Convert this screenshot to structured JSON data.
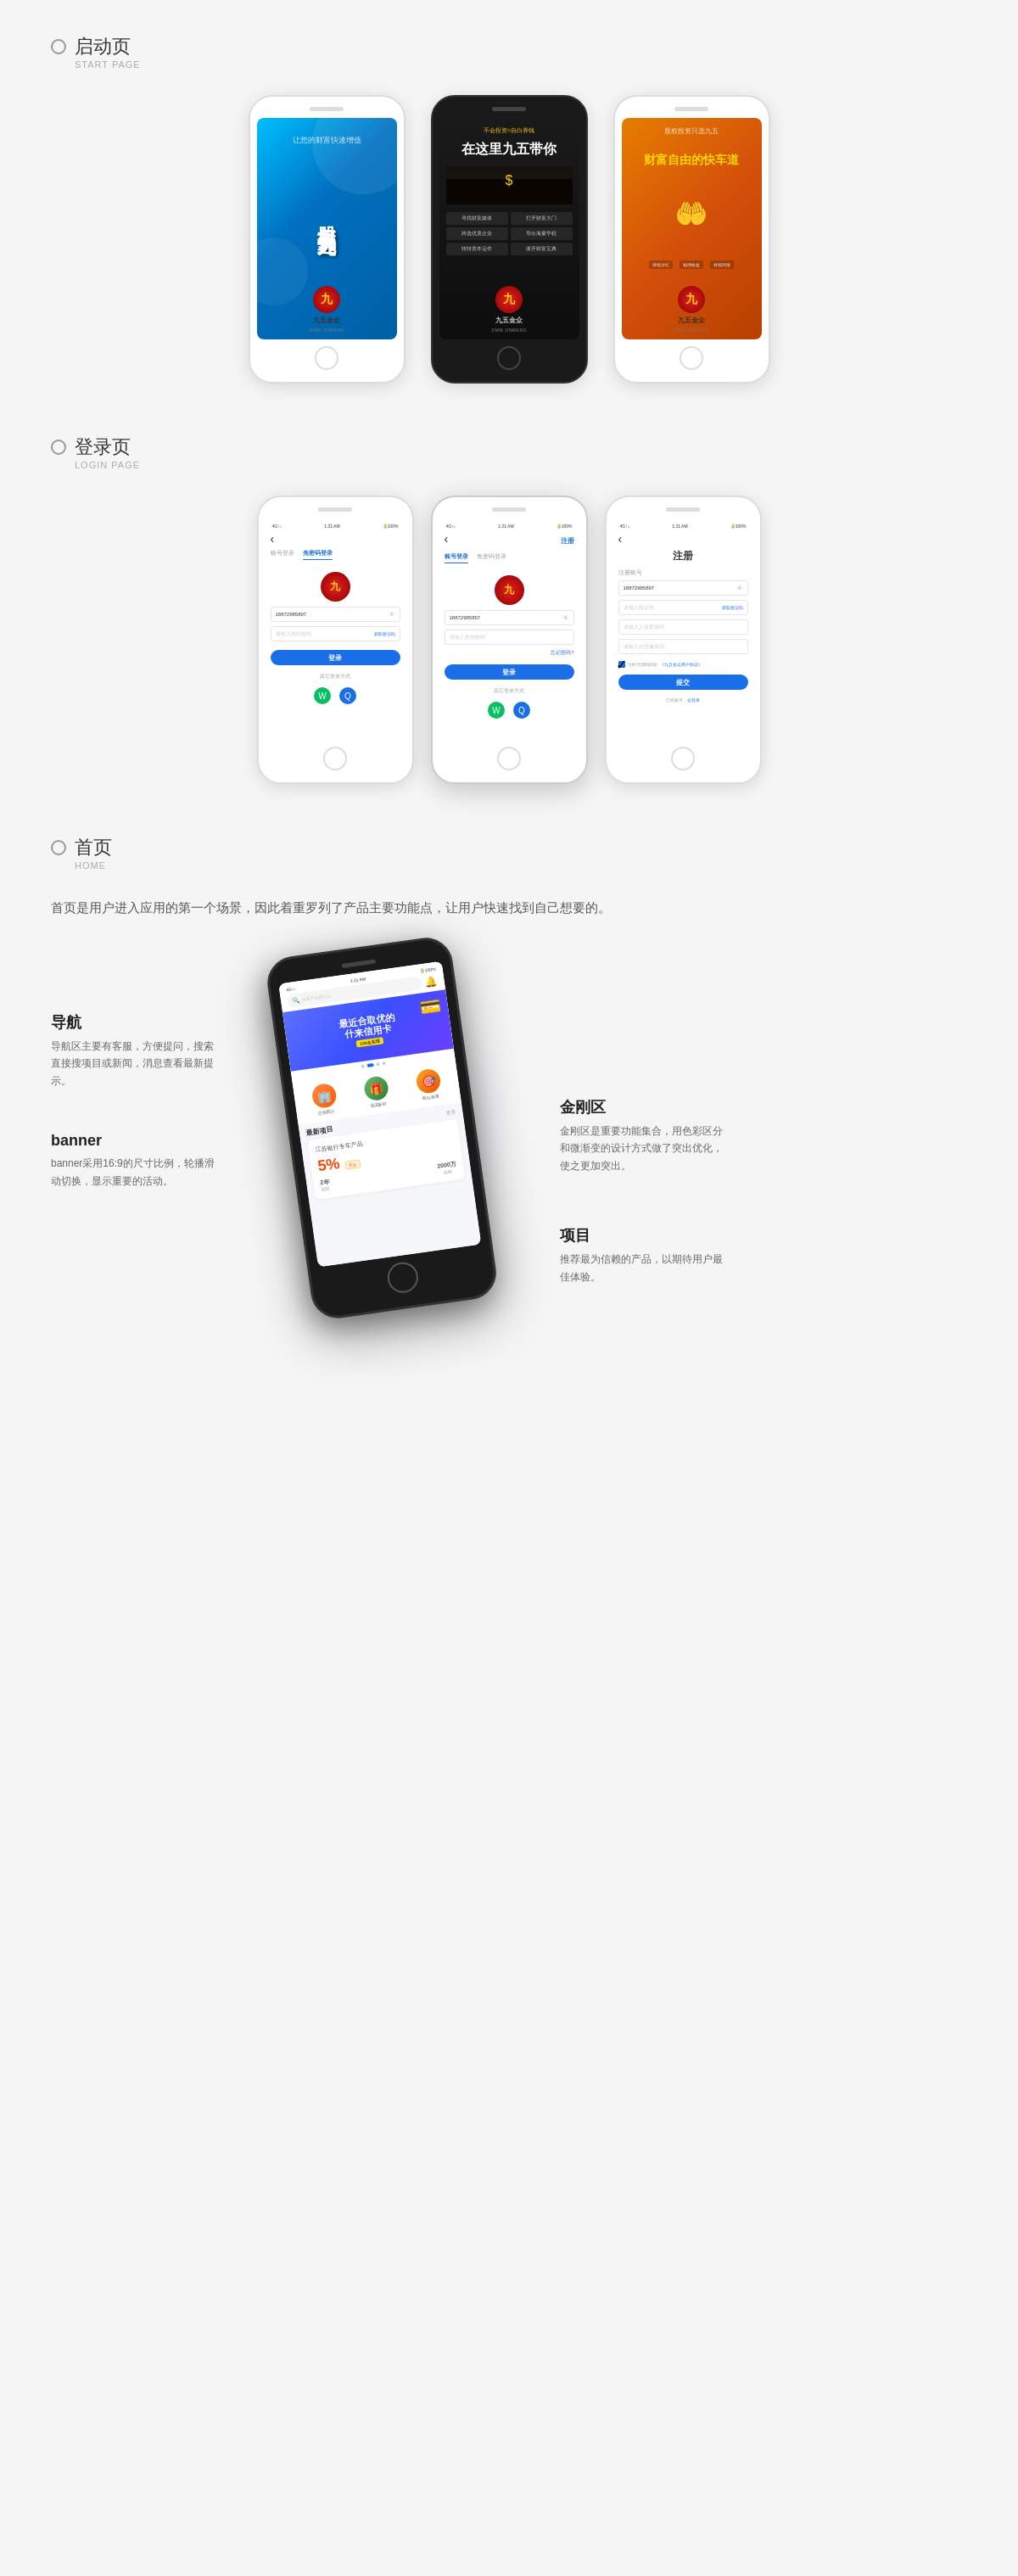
{
  "sections": {
    "start_page": {
      "title_cn": "启动页",
      "title_en": "START PAGE",
      "phones": [
        {
          "type": "blue",
          "main_text": "股权投资只选九五",
          "sub_text": "让您的财富快速增值",
          "logo_cn": "九五金众",
          "logo_en": "JIMM JINMENG"
        },
        {
          "type": "dark",
          "headline": "在这里九五带你",
          "sub1": "不会投资=自白养钱",
          "menu_items": [
            "寻找财富媒体",
            "打开财富大门",
            "跨选优质企业",
            "导出海量学程",
            "转转资本运作",
            "谢开财富宝典"
          ],
          "logo_cn": "九五金众",
          "logo_en": "JIMM JINMENG"
        },
        {
          "type": "orange",
          "headline": "财富自由的快车道",
          "features": [
            "持续分红",
            "稳增收益",
            "持续回报"
          ],
          "sub_text": "股权投资只选九五",
          "logo_cn": "九五金众",
          "logo_en": "JIMM JINMENG"
        }
      ]
    },
    "login_page": {
      "title_cn": "登录页",
      "title_en": "LOGIN PAGE",
      "screens": [
        {
          "type": "login_password",
          "statusbar": {
            "signal": "4G↑↓",
            "time": "1:21 AM",
            "battery": "100%"
          },
          "tabs": [
            "账号登录",
            "免密码登录"
          ],
          "active_tab": 0,
          "phone_value": "18872985897",
          "password_placeholder": "请输入您的密码",
          "password_right": "获取验证码",
          "login_btn": "登录",
          "other_login": "其它登录方式"
        },
        {
          "type": "login_account",
          "statusbar": {
            "signal": "4G↑↓",
            "time": "1:21 AM",
            "battery": "100%"
          },
          "tabs": [
            "账号登录",
            "免密码登录"
          ],
          "active_tab": 0,
          "register_link": "注册",
          "phone_value": "18872985897",
          "password_placeholder": "请输入您的密码",
          "login_btn": "登录",
          "forgot": "忘记密码?",
          "other_login": "其它登录方式"
        },
        {
          "type": "register",
          "statusbar": {
            "signal": "4G↑↓",
            "time": "1:21 AM",
            "battery": "100%"
          },
          "title": "注册",
          "section_title": "注册账号",
          "phone_value": "18872985897",
          "code_placeholder": "请输入验证码",
          "get_code": "获取验证码",
          "password_placeholder": "请输入人设置密码",
          "invite_placeholder": "请输入代理邀请码",
          "agreement": "注时代理码同意《九五金众用户协议》",
          "submit_btn": "提交",
          "already": "已有账号，去登录"
        }
      ]
    },
    "home_page": {
      "title_cn": "首页",
      "title_en": "HOME",
      "label": "Ed HOME",
      "description": "首页是用户进入应用的第一个场景，因此着重罗列了产品主要功能点，让用户快速找到自己想要的。",
      "annotations": {
        "nav_title": "导航",
        "nav_text": "导航区主要有客服，方便提问，搜索直接搜项目或新闻，消息查看最新提示。",
        "banner_title": "banner",
        "banner_text": "banner采用16:9的尺寸比例，轮播滑动切换，显示重要的活动。",
        "jingang_title": "金刚区",
        "jingang_text": "金刚区是重要功能集合，用色彩区分和微渐变的设计方式做了突出优化，使之更加突出。",
        "project_title": "项目",
        "project_text": "推荐最为信赖的产品，以期待用户最佳体验。"
      },
      "phone_screen": {
        "statusbar": {
          "signal": "4G↑↓",
          "time": "1:21 AM",
          "battery": "100%"
        },
        "search_placeholder": "搜索产品或公众",
        "banner": {
          "main_text": "最近合取优的",
          "sub_text": "什来信用卡",
          "badge": "100名实现",
          "dots": [
            false,
            true,
            false,
            false
          ]
        },
        "icons": [
          {
            "label": "总场能介",
            "color": "#ff6b35",
            "icon": "🏢"
          },
          {
            "label": "我是新村",
            "color": "#4caf50",
            "icon": "🎁"
          },
          {
            "label": "粗出康康",
            "color": "#ff9800",
            "icon": "🎯"
          }
        ],
        "section_title": "最新项目",
        "more_link": "更多",
        "product": {
          "bank": "江苏银行专车产品",
          "rate": "5%",
          "tag": "更多",
          "term": "2年",
          "amount": "2000万",
          "term_label": "",
          "amount_label": ""
        }
      }
    }
  }
}
